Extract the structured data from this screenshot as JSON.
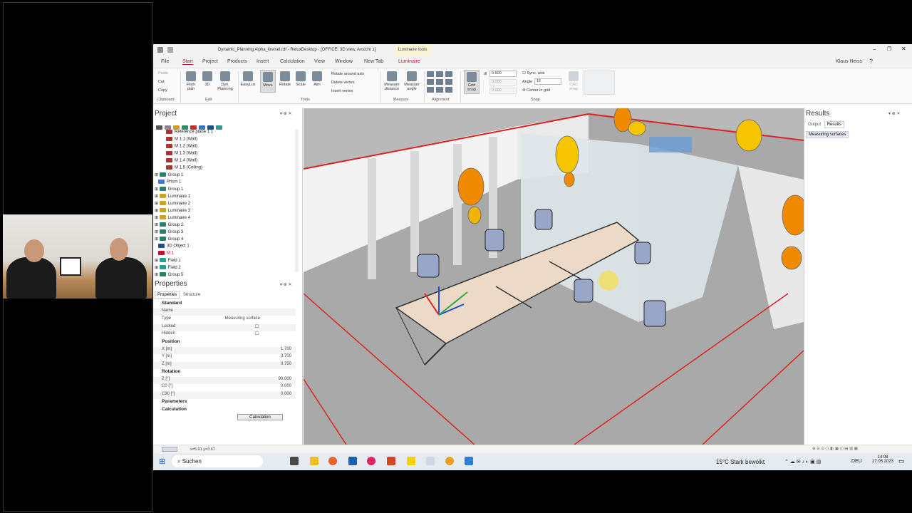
{
  "window": {
    "title": "Dynamic_Planning Alpha_kreisel.rdf - ReluxDesktop - [OFFICE: 3D view, Ansicht 1]",
    "context_tab": "Luminaire tools",
    "user": "Klaus Heiss"
  },
  "menu": {
    "items": [
      "File",
      "Start",
      "Project",
      "Products",
      "Insert",
      "Calculation",
      "View",
      "Window",
      "New Tab",
      "Luminaire"
    ],
    "active": "Start"
  },
  "ribbon": {
    "clipboard": {
      "paste": "Paste",
      "cut": "Cut",
      "copy": "Copy",
      "group": "Clipboard"
    },
    "edit": {
      "floor_plan": "Floor plan",
      "three_d": "3D",
      "dyn_planning": "Dyn. Planning",
      "group": "Edit"
    },
    "tools": {
      "easylux": "EasyLux",
      "move": "Move",
      "rotate": "Rotate",
      "scale": "Scale",
      "aim": "Aim",
      "rotate_around_axis": "Rotate around axis",
      "delete_vertex": "Delete vertex",
      "insert_vertex": "Insert vertex",
      "group": "Tools"
    },
    "measure": {
      "distance": "Measure distance",
      "angle": "Measure angle",
      "group": "Measure"
    },
    "alignment": {
      "group": "Alignment"
    },
    "snap": {
      "grid_snap": "Grid snap",
      "dl_label": "dl",
      "dl_value": "0.500",
      "d2_value": "0.000",
      "d3_value": "0.000",
      "sync_axis": "Sync. axis",
      "angle_label": "Angle",
      "angle_value": "15",
      "center_in_grid": "Center in grid",
      "cad_snap": "CAD snap",
      "group": "Snap"
    }
  },
  "project": {
    "title": "Project",
    "tree": [
      "Reference plane 1.1",
      "M 1.1 (Wall)",
      "M 1.2 (Wall)",
      "M 1.3 (Wall)",
      "M 1.4 (Wall)",
      "M 1.5 (Ceiling)",
      "Group 1",
      "Prism 1",
      "Group 1",
      "Luminaire 1",
      "Luminaire 2",
      "Luminaire 3",
      "Luminaire 4",
      "Group 2",
      "Group 3",
      "Group 4",
      "3D Object 1",
      "M 1",
      "Field 1",
      "Field 2",
      "Group 5"
    ]
  },
  "properties": {
    "title": "Properties",
    "tabs": [
      "Properties",
      "Structure"
    ],
    "sections": {
      "standard": "Standard",
      "position": "Position",
      "rotation": "Rotation",
      "parameters": "Parameters",
      "calculation": "Calculation"
    },
    "rows": {
      "name": {
        "label": "Name",
        "value": ""
      },
      "type": {
        "label": "Type",
        "value": "Measuring surface"
      },
      "locked": {
        "label": "Locked"
      },
      "hidden": {
        "label": "Hidden"
      },
      "x": {
        "label": "X [m]",
        "value": "1.700"
      },
      "y": {
        "label": "Y [m]",
        "value": "3.700"
      },
      "z": {
        "label": "Z [m]",
        "value": "0.750"
      },
      "zdeg": {
        "label": "Z [°]",
        "value": "90.000"
      },
      "c0": {
        "label": "C0 [°]",
        "value": "0.000"
      },
      "c90": {
        "label": "C90 [°]",
        "value": "0.000"
      }
    },
    "calc_button": "Calculation"
  },
  "results": {
    "title": "Results",
    "tabs": [
      "Output",
      "Results"
    ],
    "active_tab": "Results",
    "subtab": "Measuring surfaces"
  },
  "status": {
    "coords": "x=5.91 y=3.67"
  },
  "taskbar": {
    "search": "Suchen",
    "weather": "15°C  Stark bewölkt",
    "lang": "DEU",
    "time": "14:08",
    "date": "17.05.2023"
  },
  "colors": {
    "accent": "#c8102e",
    "luminaire": "#f08a00",
    "ribbon_bg": "#fafafa"
  }
}
